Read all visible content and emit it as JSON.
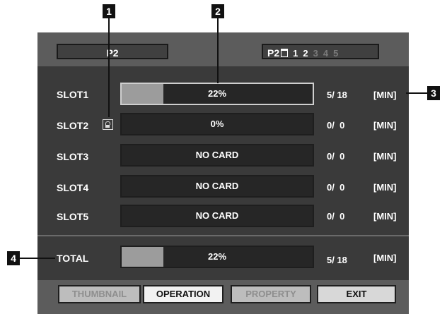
{
  "header": {
    "title": "P2",
    "slot_selector": {
      "prefix": "P2",
      "numbers": [
        {
          "label": "1",
          "active": true
        },
        {
          "label": "2",
          "active": true
        },
        {
          "label": "3",
          "active": false
        },
        {
          "label": "4",
          "active": false
        },
        {
          "label": "5",
          "active": false
        }
      ]
    }
  },
  "slots": [
    {
      "label": "SLOT1",
      "fill_percent": 22,
      "text": "22%",
      "count": "5/ 18",
      "unit": "[MIN]",
      "locked": false,
      "active": true
    },
    {
      "label": "SLOT2",
      "fill_percent": 0,
      "text": "0%",
      "count": "0/  0",
      "unit": "[MIN]",
      "locked": true,
      "active": false
    },
    {
      "label": "SLOT3",
      "fill_percent": 0,
      "text": "NO CARD",
      "count": "0/  0",
      "unit": "[MIN]",
      "locked": false,
      "active": false
    },
    {
      "label": "SLOT4",
      "fill_percent": 0,
      "text": "NO CARD",
      "count": "0/  0",
      "unit": "[MIN]",
      "locked": false,
      "active": false
    },
    {
      "label": "SLOT5",
      "fill_percent": 0,
      "text": "NO CARD",
      "count": "0/  0",
      "unit": "[MIN]",
      "locked": false,
      "active": false
    }
  ],
  "total": {
    "label": "TOTAL",
    "fill_percent": 22,
    "text": "22%",
    "count": "5/ 18",
    "unit": "[MIN]"
  },
  "buttons": [
    {
      "label": "THUMBNAIL",
      "state": "disabled"
    },
    {
      "label": "OPERATION",
      "state": "selected"
    },
    {
      "label": "PROPERTY",
      "state": "disabled"
    },
    {
      "label": "EXIT",
      "state": "enabled"
    }
  ],
  "callouts": [
    "1",
    "2",
    "3",
    "4"
  ],
  "icons": {
    "write_protect": "lock-icon",
    "card": "card-icon"
  }
}
